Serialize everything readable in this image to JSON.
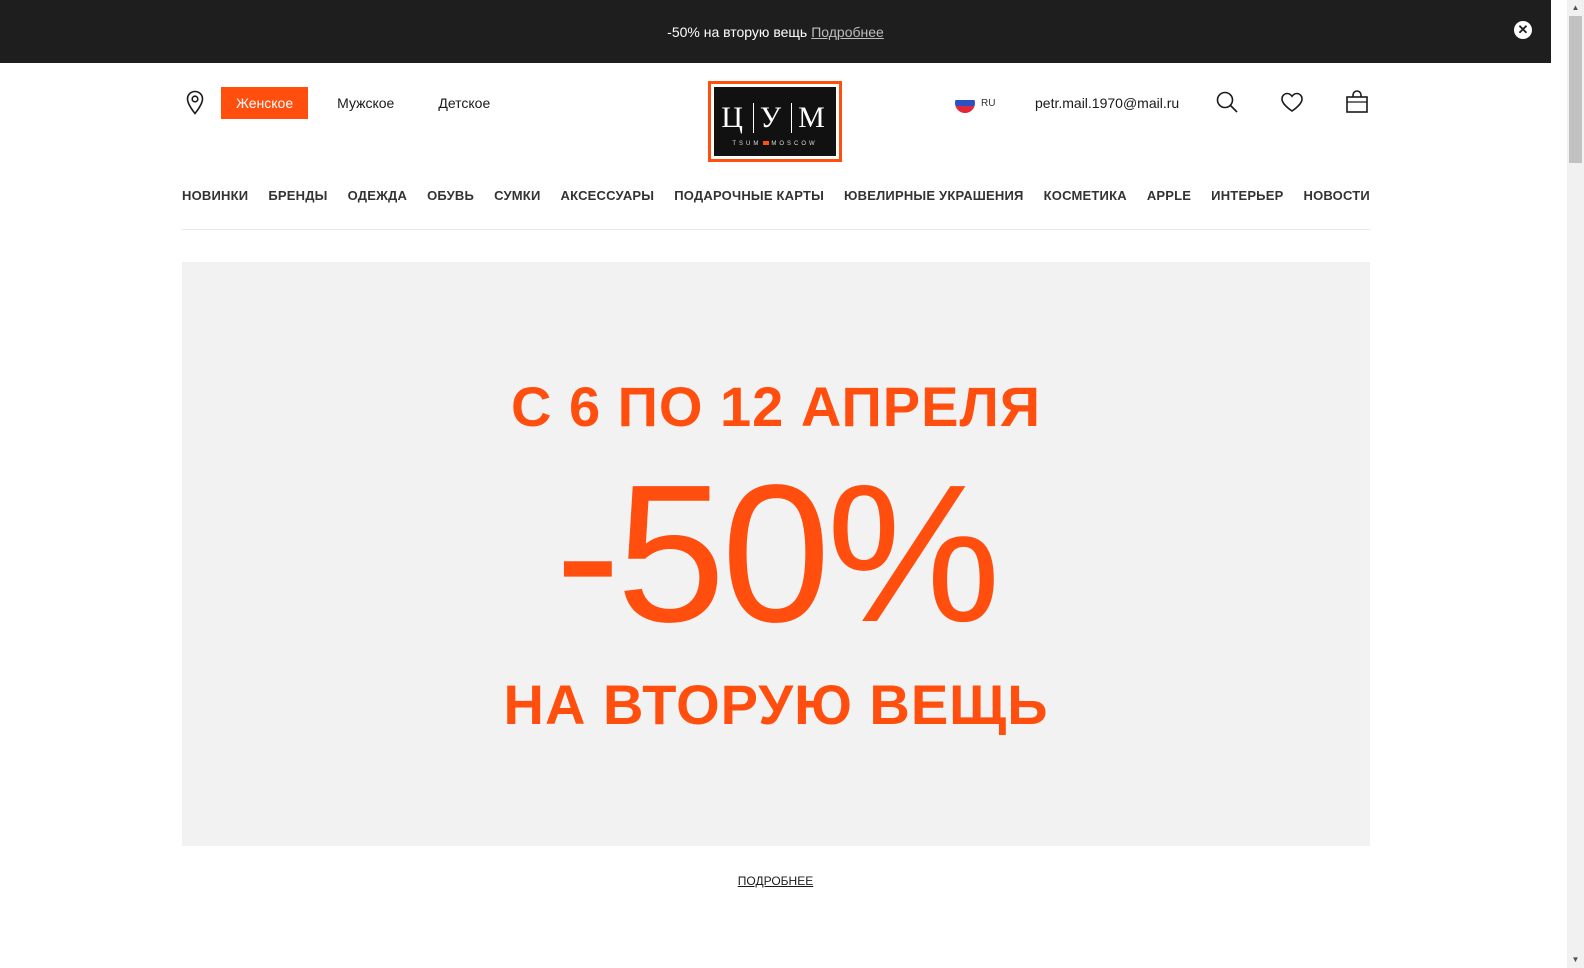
{
  "promo": {
    "text": "-50% на вторую вещь",
    "link": "Подробнее",
    "close_symbol": "✕"
  },
  "header": {
    "gender_tabs": [
      "Женское",
      "Мужское",
      "Детское"
    ],
    "active_tab": "Женское",
    "logo": {
      "letters": [
        "Ц",
        "У",
        "М"
      ],
      "sub_left": "TSUM",
      "sub_right": "MOSCOW"
    },
    "language": "RU",
    "user_email": "petr.mail.1970@mail.ru",
    "icons": [
      "location-icon",
      "search-icon",
      "heart-icon",
      "bag-icon"
    ]
  },
  "nav": {
    "items": [
      "НОВИНКИ",
      "БРЕНДЫ",
      "ОДЕЖДА",
      "ОБУВЬ",
      "СУМКИ",
      "АКСЕССУАРЫ",
      "ПОДАРОЧНЫЕ КАРТЫ",
      "ЮВЕЛИРНЫЕ УКРАШЕНИЯ",
      "КОСМЕТИКА",
      "APPLE",
      "ИНТЕРЬЕР",
      "НОВОСТИ"
    ]
  },
  "banner": {
    "line1": "С 6 ПО 12 АПРЕЛЯ",
    "line2": "-50%",
    "line3": "НА ВТОРУЮ ВЕЩЬ",
    "more_link": "ПОДРОБНЕЕ"
  },
  "colors": {
    "accent": "#ff4e0e",
    "dark": "#1e1e1e",
    "banner_bg": "#f2f2f2"
  }
}
